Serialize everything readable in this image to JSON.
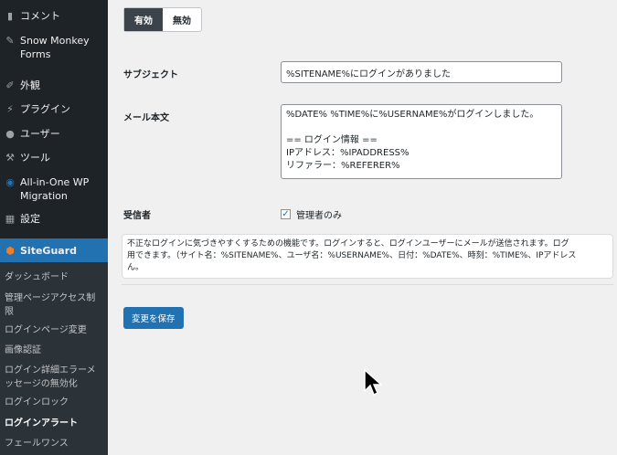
{
  "sidebar": {
    "items": [
      {
        "icon": "comment-icon",
        "label": "コメント"
      },
      {
        "icon": "pin-icon",
        "label": "Snow Monkey\nForms"
      },
      {
        "icon": "brush-icon",
        "label": "外観"
      },
      {
        "icon": "plugin-icon",
        "label": "プラグイン"
      },
      {
        "icon": "user-icon",
        "label": "ユーザー"
      },
      {
        "icon": "wrench-icon",
        "label": "ツール"
      },
      {
        "icon": "migration-icon",
        "label": "All-in-One WP\nMigration"
      },
      {
        "icon": "settings-icon",
        "label": "設定"
      }
    ],
    "siteguard": "SiteGuard",
    "sub": [
      "ダッシュボード",
      "管理ページアクセス制\n限",
      "ログインページ変更",
      "画像認証",
      "ログイン詳細エラーメ\nッセージの無効化",
      "ログインロック",
      "ログインアラート",
      "フェールワンス"
    ]
  },
  "main": {
    "toggle": {
      "on": "有効",
      "off": "無効"
    },
    "subject_label": "サブジェクト",
    "subject_value": "%SITENAME%にログインがありました",
    "body_label": "メール本文",
    "body_value": "%DATE% %TIME%に%USERNAME%がログインしました。\n\n== ログイン情報 ==\nIPアドレス：%IPADDRESS%\nリファラー：%REFERER%",
    "recipient_label": "受信者",
    "recipient_option": "管理者のみ",
    "description": "不正なログインに気づきやすくするための機能です。ログインすると、ログインユーザーにメールが送信されます。ログ\n用できます。（サイト名：%SITENAME%、ユーザ名：%USERNAME%、日付：%DATE%、時刻：%TIME%、IPアドレス\nん。",
    "save": "変更を保存"
  }
}
